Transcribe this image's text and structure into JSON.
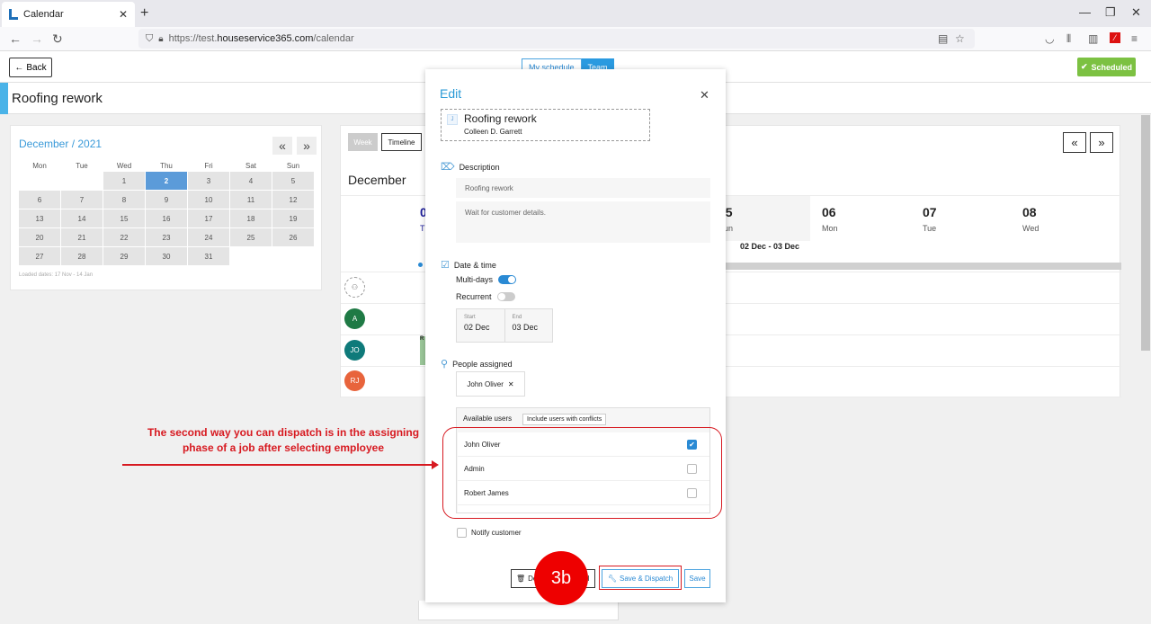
{
  "browser": {
    "tab_title": "Calendar",
    "url_prefix": "https://test.",
    "url_domain": "houseservice365.com",
    "url_path": "/calendar"
  },
  "app": {
    "back_label": "Back",
    "view_toggle": [
      "My schedule",
      "Team"
    ],
    "status_label": "Scheduled",
    "job_title": "Roofing rework"
  },
  "mini_calendar": {
    "title": "December / 2021",
    "weekdays": [
      "Mon",
      "Tue",
      "Wed",
      "Thu",
      "Fri",
      "Sat",
      "Sun"
    ],
    "weeks": [
      [
        "",
        "",
        "1",
        "2",
        "3",
        "4",
        "5"
      ],
      [
        "6",
        "7",
        "8",
        "9",
        "10",
        "11",
        "12"
      ],
      [
        "13",
        "14",
        "15",
        "16",
        "17",
        "18",
        "19"
      ],
      [
        "20",
        "21",
        "22",
        "23",
        "24",
        "25",
        "26"
      ],
      [
        "27",
        "28",
        "29",
        "30",
        "31",
        "",
        ""
      ]
    ],
    "selected": "2",
    "loaded_dates": "Loaded dates: 17 Nov - 14 Jan"
  },
  "main_calendar": {
    "views": [
      "Week",
      "Timeline"
    ],
    "month": "December",
    "days": [
      {
        "num": "05",
        "name": "Sun"
      },
      {
        "num": "06",
        "name": "Mon"
      },
      {
        "num": "07",
        "name": "Tue"
      },
      {
        "num": "08",
        "name": "Wed"
      }
    ],
    "hidden_day": {
      "num": "0",
      "name": "Th"
    },
    "range_label": "02 Dec - 03 Dec",
    "avatars": [
      {
        "initials": "",
        "color": "#ffffff"
      },
      {
        "initials": "A",
        "color": "#1f7a45"
      },
      {
        "initials": "JO",
        "color": "#0f7a7a"
      },
      {
        "initials": "RJ",
        "color": "#e8643c"
      }
    ],
    "event_label": "R"
  },
  "modal": {
    "title": "Edit",
    "job": {
      "icon": "J",
      "title": "Roofing rework",
      "client": "Colleen D. Garrett"
    },
    "description": {
      "label": "Description",
      "title_value": "Roofing rework",
      "notes_value": "Wait for customer details."
    },
    "datetime": {
      "label": "Date & time",
      "multi_days": "Multi-days",
      "recurrent": "Recurrent",
      "start_label": "Start",
      "start_value": "02 Dec",
      "end_label": "End",
      "end_value": "03 Dec"
    },
    "people": {
      "label": "People assigned",
      "chip": "John Oliver",
      "available_label": "Available users",
      "include_conflicts": "Include users with conflicts",
      "users": [
        {
          "name": "John Oliver",
          "checked": true
        },
        {
          "name": "Admin",
          "checked": false
        },
        {
          "name": "Robert James",
          "checked": false
        }
      ]
    },
    "notify_label": "Notify customer",
    "buttons": {
      "delete": "De",
      "cancel": "l",
      "save_dispatch": "Save & Dispatch",
      "save": "Save"
    }
  },
  "annotation": {
    "line1": "The second way you can dispatch is in the assigning",
    "line2": "phase of a job after selecting employee",
    "step": "3b"
  }
}
